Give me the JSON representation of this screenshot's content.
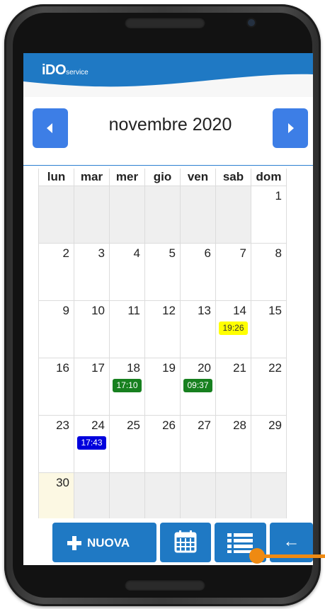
{
  "app": {
    "logo_main": "iDO",
    "logo_sub": "service"
  },
  "calendar": {
    "month_label": "novembre 2020",
    "weekdays": [
      "lun",
      "mar",
      "mer",
      "gio",
      "ven",
      "sab",
      "dom"
    ],
    "weeks": [
      [
        {
          "day": ""
        },
        {
          "day": ""
        },
        {
          "day": ""
        },
        {
          "day": ""
        },
        {
          "day": ""
        },
        {
          "day": ""
        },
        {
          "day": "1"
        }
      ],
      [
        {
          "day": "2"
        },
        {
          "day": "3"
        },
        {
          "day": "4"
        },
        {
          "day": "5"
        },
        {
          "day": "6"
        },
        {
          "day": "7"
        },
        {
          "day": "8"
        }
      ],
      [
        {
          "day": "9"
        },
        {
          "day": "10"
        },
        {
          "day": "11"
        },
        {
          "day": "12"
        },
        {
          "day": "13"
        },
        {
          "day": "14",
          "event": {
            "time": "19:26",
            "color": "#ffff00",
            "text_color": "#333333"
          }
        },
        {
          "day": "15"
        }
      ],
      [
        {
          "day": "16"
        },
        {
          "day": "17"
        },
        {
          "day": "18",
          "event": {
            "time": "17:10",
            "color": "#17801f",
            "text_color": "#ffffff"
          }
        },
        {
          "day": "19"
        },
        {
          "day": "20",
          "event": {
            "time": "09:37",
            "color": "#17801f",
            "text_color": "#ffffff"
          }
        },
        {
          "day": "21"
        },
        {
          "day": "22"
        }
      ],
      [
        {
          "day": "23"
        },
        {
          "day": "24",
          "event": {
            "time": "17:43",
            "color": "#0000dd",
            "text_color": "#ffffff"
          }
        },
        {
          "day": "25"
        },
        {
          "day": "26"
        },
        {
          "day": "27"
        },
        {
          "day": "28"
        },
        {
          "day": "29"
        }
      ],
      [
        {
          "day": "30",
          "today": true
        },
        {
          "day": ""
        },
        {
          "day": ""
        },
        {
          "day": ""
        },
        {
          "day": ""
        },
        {
          "day": ""
        },
        {
          "day": ""
        }
      ]
    ]
  },
  "toolbar": {
    "new_label": "NUOVA",
    "back_label": "←",
    "icons": {
      "new": "plus-icon",
      "calendar": "calendar-icon",
      "list": "list-icon"
    }
  },
  "colors": {
    "brand": "#1f79c4",
    "nav_button": "#3d7ee6",
    "pointer": "#ef8a12"
  }
}
